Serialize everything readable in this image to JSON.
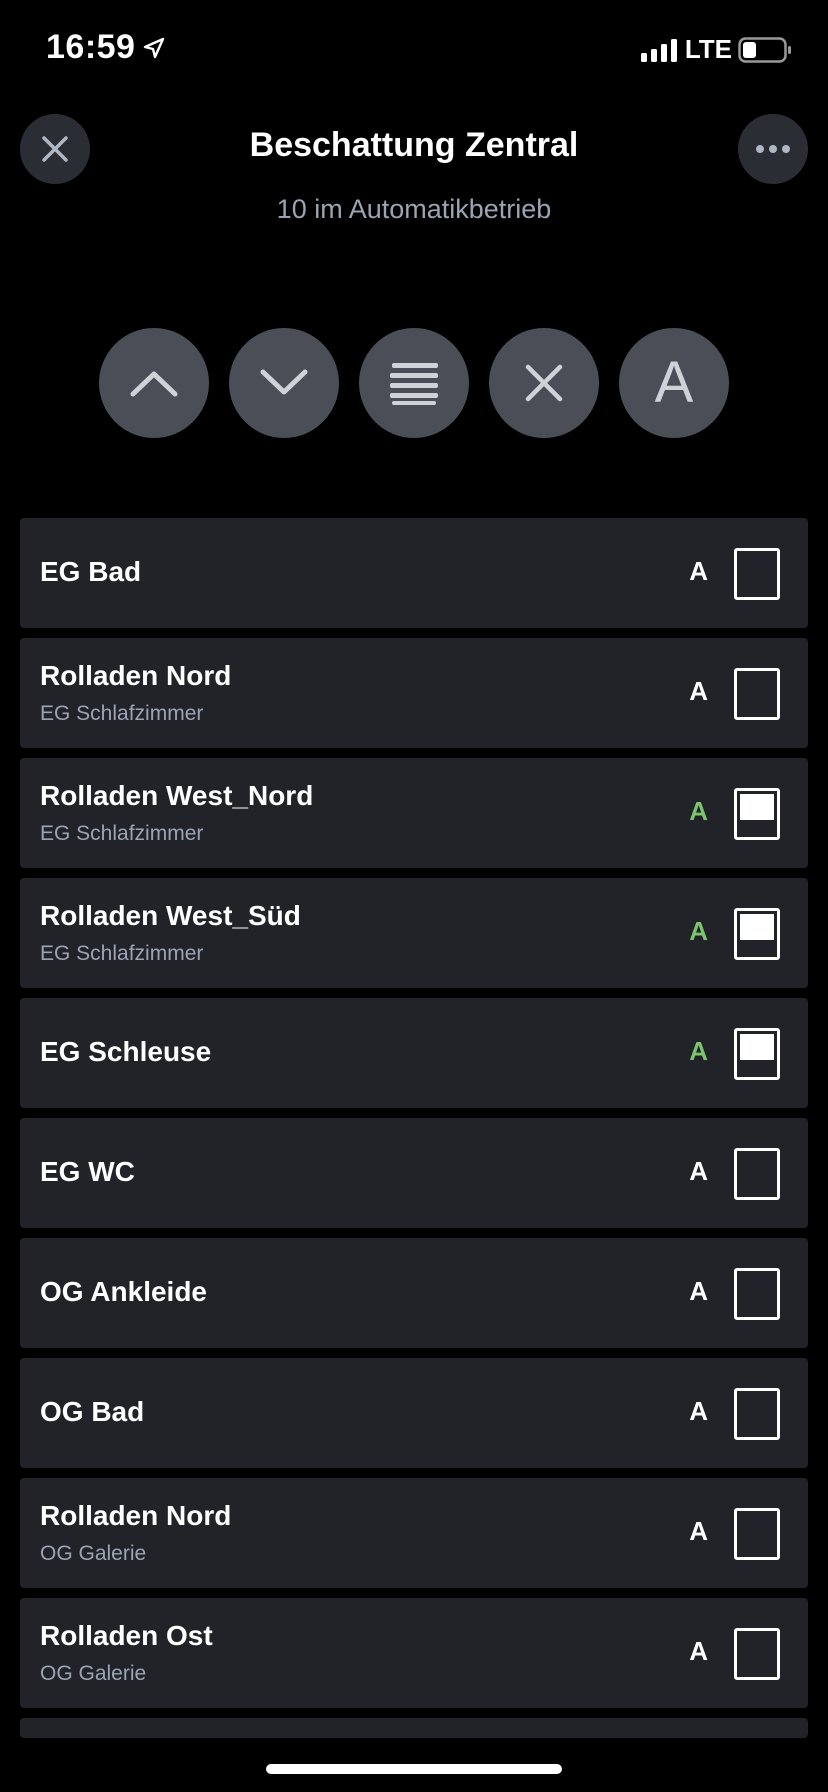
{
  "status_bar": {
    "time": "16:59",
    "network": "LTE"
  },
  "header": {
    "title": "Beschattung Zentral",
    "subtitle": "10 im Automatikbetrieb",
    "close_icon": "close-icon",
    "more_icon": "more-dots-icon"
  },
  "actions": {
    "up_icon": "chevron-up-icon",
    "down_icon": "chevron-down-icon",
    "shade_icon": "shade-slats-icon",
    "stop_icon": "stop-x-icon",
    "auto_label": "A"
  },
  "colors": {
    "background": "#000000",
    "row_background": "#212329",
    "button_background": "#4a4f57",
    "auto_active": "#7cc36e",
    "subtitle": "#9aa4b4"
  },
  "devices": [
    {
      "name": "EG Bad",
      "room": "",
      "auto": "A",
      "auto_active": false,
      "shade_level": 0
    },
    {
      "name": "Rolladen Nord",
      "room": "EG Schlafzimmer",
      "auto": "A",
      "auto_active": false,
      "shade_level": 0
    },
    {
      "name": "Rolladen West_Nord",
      "room": "EG Schlafzimmer",
      "auto": "A",
      "auto_active": true,
      "shade_level": 0.75
    },
    {
      "name": "Rolladen West_Süd",
      "room": "EG Schlafzimmer",
      "auto": "A",
      "auto_active": true,
      "shade_level": 0.75
    },
    {
      "name": "EG Schleuse",
      "room": "",
      "auto": "A",
      "auto_active": true,
      "shade_level": 0.75
    },
    {
      "name": "EG WC",
      "room": "",
      "auto": "A",
      "auto_active": false,
      "shade_level": 0
    },
    {
      "name": "OG Ankleide",
      "room": "",
      "auto": "A",
      "auto_active": false,
      "shade_level": 0
    },
    {
      "name": "OG Bad",
      "room": "",
      "auto": "A",
      "auto_active": false,
      "shade_level": 0
    },
    {
      "name": "Rolladen Nord",
      "room": "OG Galerie",
      "auto": "A",
      "auto_active": false,
      "shade_level": 0
    },
    {
      "name": "Rolladen Ost",
      "room": "OG Galerie",
      "auto": "A",
      "auto_active": false,
      "shade_level": 0
    }
  ]
}
